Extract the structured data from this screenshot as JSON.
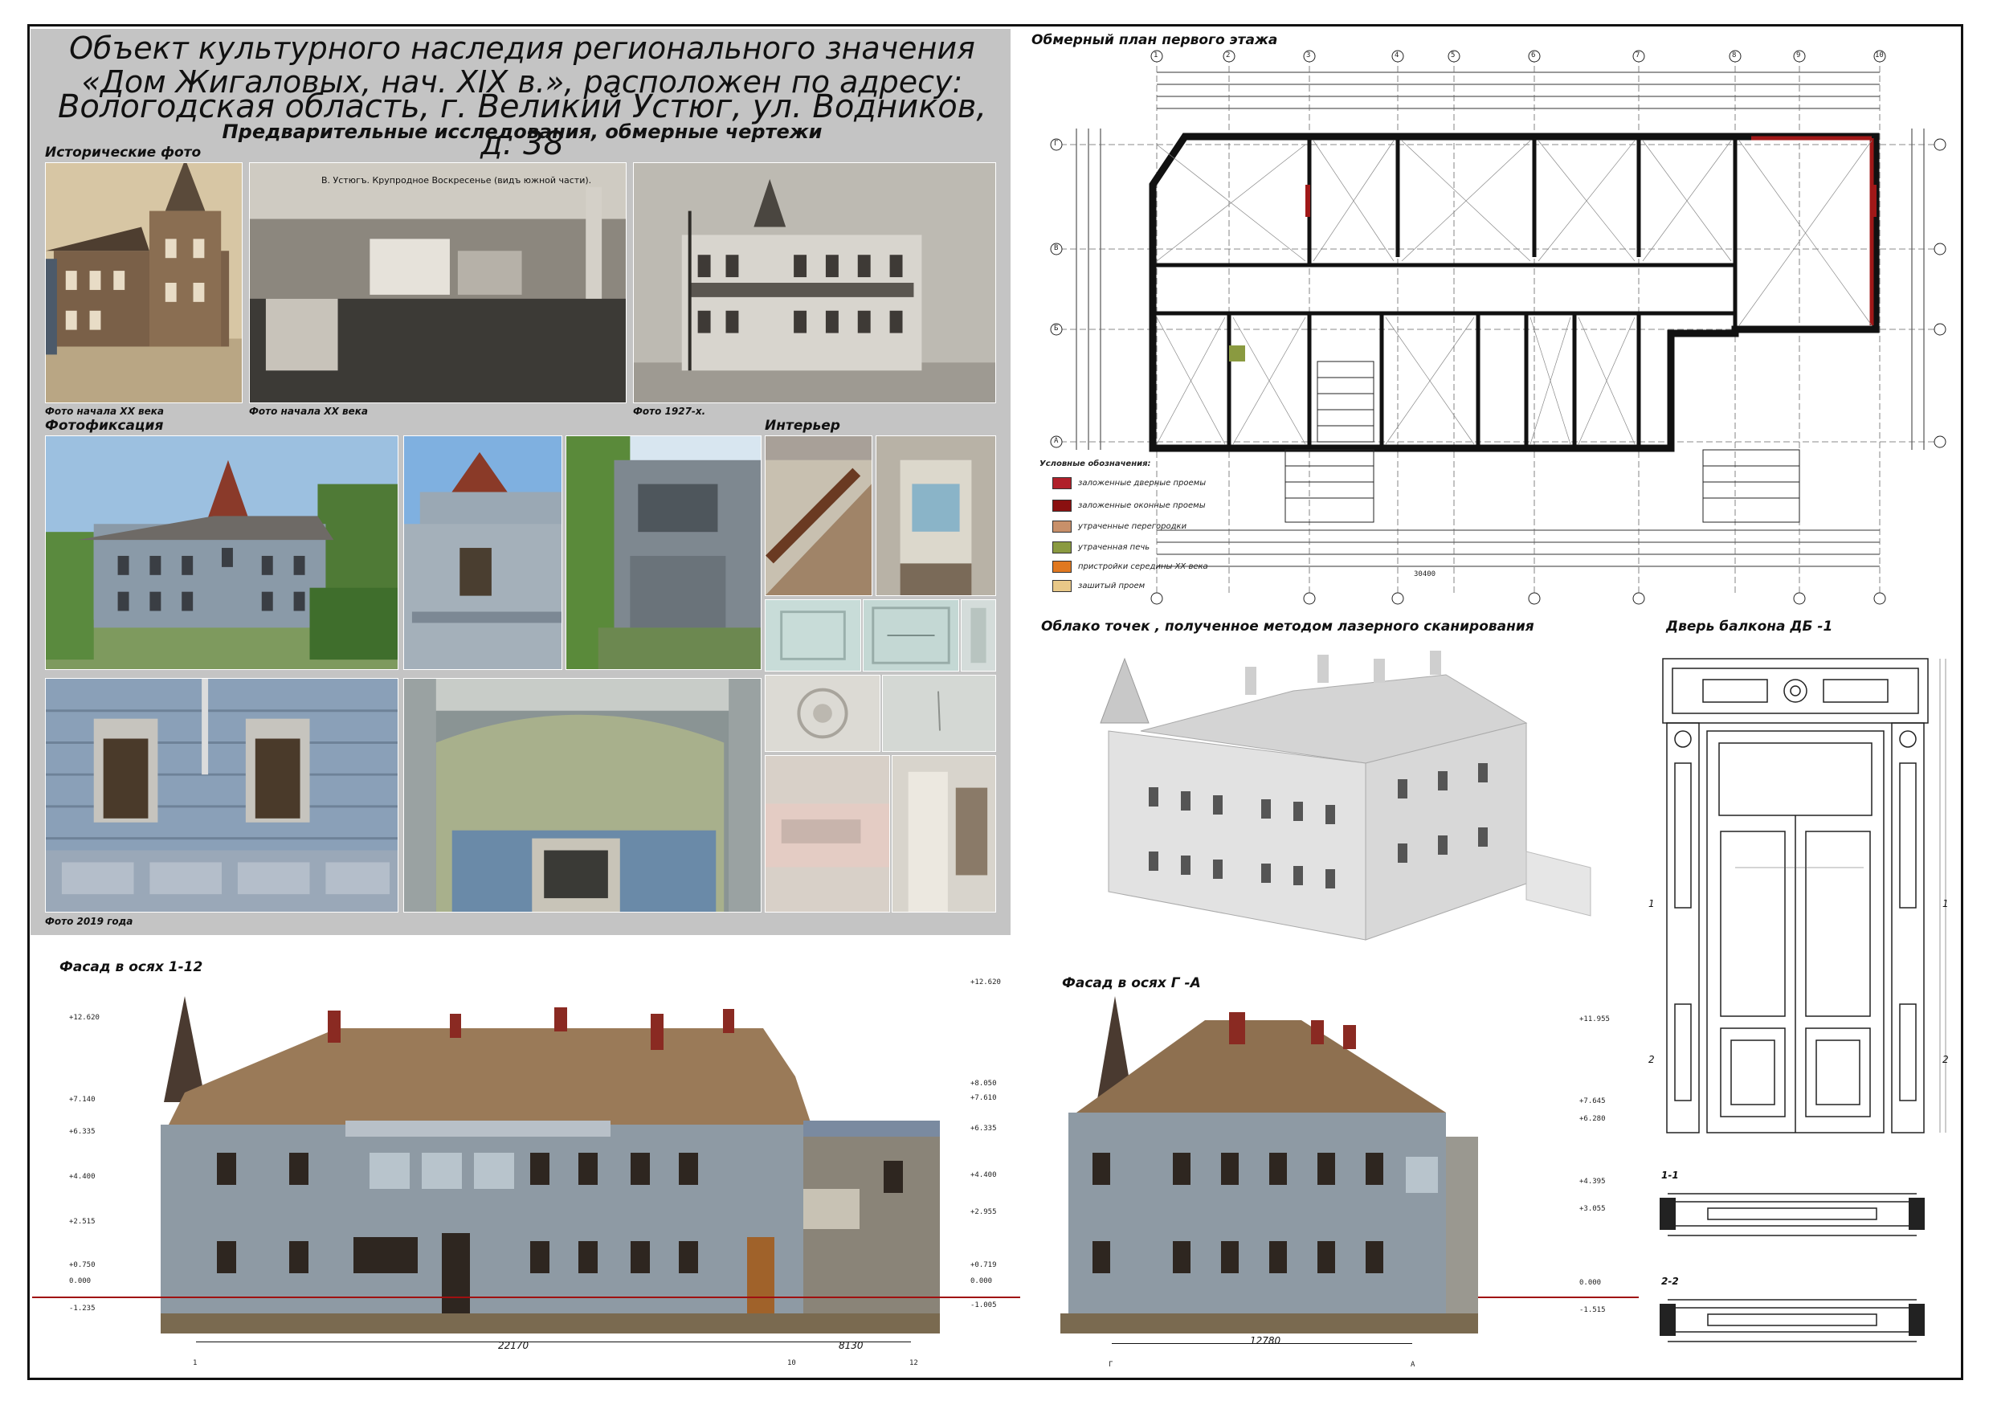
{
  "header": {
    "line1": "Объект культурного наследия регионального значения",
    "line2": "«Дом Жигаловых,  нач. XIX в.», расположен по адресу:",
    "line3": "Вологодская область, г. Великий Устюг, ул. Водников, д. 38",
    "subtitle": "Предварительные исследования, обмерные чертежи"
  },
  "sections": {
    "historic": "Исторические фото",
    "fixation": "Фотофиксация",
    "interior": "Интерьер",
    "plan": "Обмерный план первого этажа",
    "cloud": "Облако точек , полученное методом лазерного сканирования",
    "door": "Дверь балкона ДБ -1",
    "facade1": "Фасад в осях  1-12",
    "facade2": "Фасад в осях  Г -А"
  },
  "captions": {
    "photo1": "Фото начала XX века",
    "photo2": "Фото начала XX века",
    "photo3": "Фото  1927-х.",
    "photo2019": "Фото  2019  года",
    "postcard": "В. Устюгъ.  Крупродное Воскресенье (видъ южной части)."
  },
  "legend": {
    "title": "Условные обозначения:",
    "items": [
      {
        "label": "заложенные дверные проемы",
        "color": "#b0202a"
      },
      {
        "label": "заложенные оконные проемы",
        "color": "#8a1010"
      },
      {
        "label": "утраченные перегородки",
        "color": "#c8906a"
      },
      {
        "label": "утраченная печь",
        "color": "#8a9a40"
      },
      {
        "label": "пристройки середины XX века",
        "color": "#e07820"
      },
      {
        "label": "зашитый проем",
        "color": "#e8c888"
      }
    ]
  },
  "facade1_dims": {
    "left_levels": [
      "+12.620",
      "+7.140",
      "+6.335",
      "+4.400",
      "+2.515",
      "+0.750",
      "0.000",
      "-1.235"
    ],
    "right_levels": [
      "+12.620",
      "+8.050",
      "+7.610",
      "+6.335",
      "+4.400",
      "+2.955",
      "+0.719",
      "0.000",
      "-1.005"
    ],
    "span1": "22170",
    "span2": "8130",
    "axis_left": "1",
    "axis_mid": "10",
    "axis_right": "12"
  },
  "facade2_dims": {
    "right_levels": [
      "+11.955",
      "+7.645",
      "+6.280",
      "+4.395",
      "+3.055",
      "0.000",
      "-1.515"
    ],
    "span": "12780",
    "axis_left": "Г",
    "axis_right": "А"
  },
  "plan_axes": {
    "top": [
      "1",
      "2",
      "3",
      "4",
      "5",
      "6",
      "7",
      "8",
      "9",
      "10"
    ],
    "left": [
      "Г",
      "В",
      "Б",
      "А"
    ],
    "overall": "30400"
  },
  "door_sections": [
    "1-1",
    "2-2"
  ],
  "door_marks": [
    "1",
    "2",
    "1",
    "2"
  ]
}
